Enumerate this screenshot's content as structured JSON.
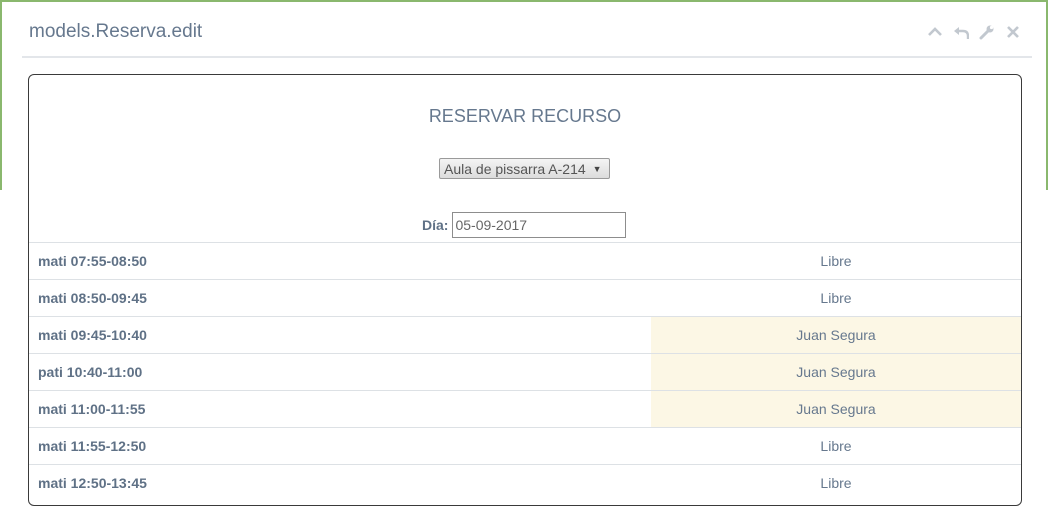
{
  "panel": {
    "title": "models.Reserva.edit",
    "tools": [
      "chevron-up-icon",
      "undo-icon",
      "wrench-icon",
      "close-icon"
    ]
  },
  "form": {
    "title": "RESERVAR RECURSO",
    "resource": "Aula de pissarra A-214",
    "day_label": "Día:",
    "day_value": "05-09-2017"
  },
  "slots": [
    {
      "time": "mati 07:55-08:50",
      "status": "Libre",
      "busy": false
    },
    {
      "time": "mati 08:50-09:45",
      "status": "Libre",
      "busy": false
    },
    {
      "time": "mati 09:45-10:40",
      "status": "Juan Segura",
      "busy": true
    },
    {
      "time": "pati 10:40-11:00",
      "status": "Juan Segura",
      "busy": true
    },
    {
      "time": "mati 11:00-11:55",
      "status": "Juan Segura",
      "busy": true
    },
    {
      "time": "mati 11:55-12:50",
      "status": "Libre",
      "busy": false
    },
    {
      "time": "mati 12:50-13:45",
      "status": "Libre",
      "busy": false
    }
  ],
  "colors": {
    "accent_border": "#8ab86e",
    "busy_bg": "#fcf7e5",
    "text": "#5f7186"
  }
}
